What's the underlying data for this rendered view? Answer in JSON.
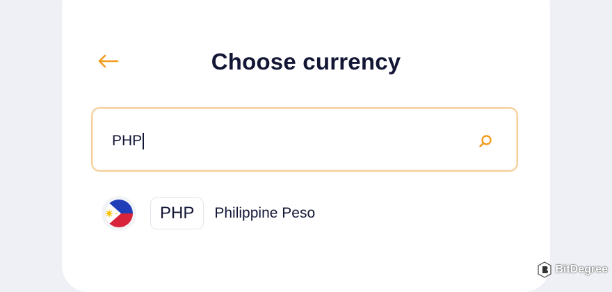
{
  "page": {
    "title": "Choose currency"
  },
  "search": {
    "value": "PHP"
  },
  "results": [
    {
      "code": "PHP",
      "name": "Philippine Peso",
      "flag_icon": "philippines-flag-icon"
    }
  ],
  "icons": {
    "back": "arrow-left-icon",
    "search": "search-icon"
  },
  "watermark": {
    "text": "BitDegree"
  },
  "colors": {
    "accent": "#f39c1f",
    "text": "#131735",
    "background": "#eef0f5",
    "search_border": "#f6cf9c"
  }
}
